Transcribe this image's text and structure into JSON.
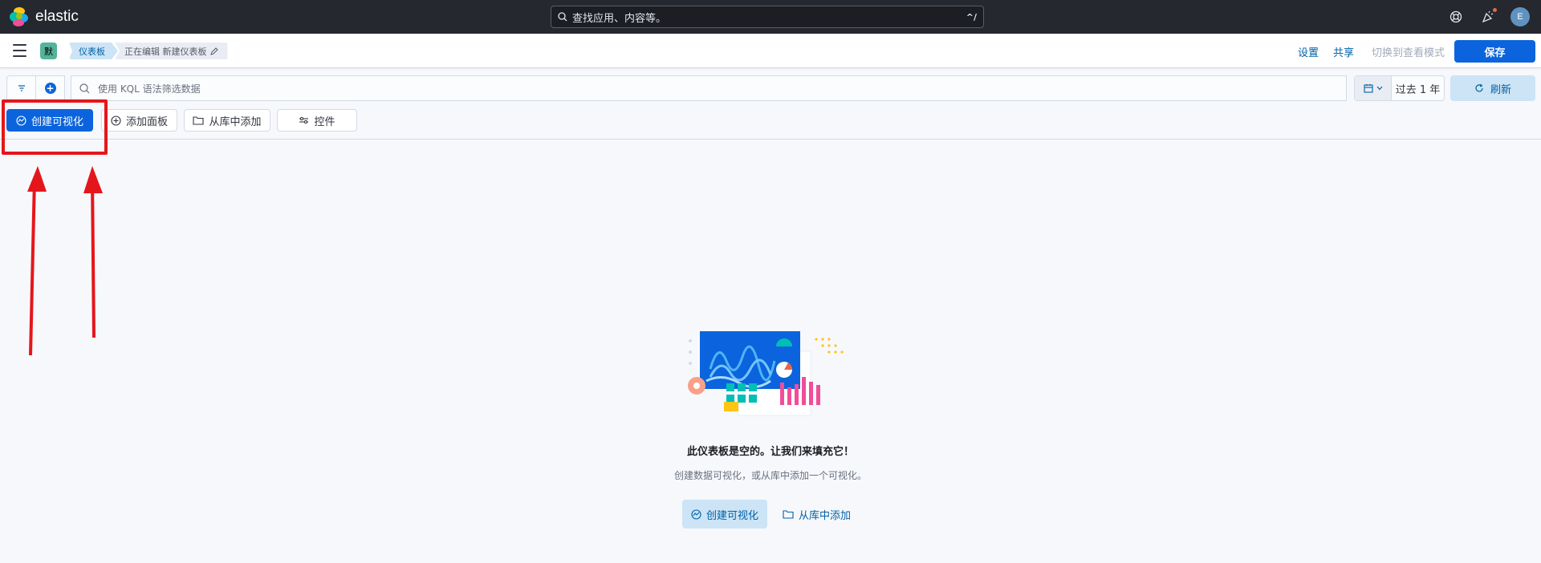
{
  "header": {
    "brand": "elastic",
    "search_placeholder": "查找应用、内容等。",
    "search_shortcut": "^/",
    "avatar_initial": "E"
  },
  "breadcrumbs": {
    "space_initial": "默",
    "items": [
      "仪表板",
      "正在编辑 新建仪表板"
    ]
  },
  "header_actions": {
    "settings": "设置",
    "share": "共享",
    "switch_view": "切换到查看模式",
    "save": "保存"
  },
  "query": {
    "placeholder": "使用 KQL 语法筛选数据",
    "date_range": "过去 1 年",
    "refresh": "刷新"
  },
  "toolbar": {
    "create_visualization": "创建可视化",
    "add_panel": "添加面板",
    "add_from_library": "从库中添加",
    "controls": "控件"
  },
  "empty_state": {
    "title": "此仪表板是空的。让我们来填充它！",
    "description": "创建数据可视化，或从库中添加一个可视化。",
    "create_visualization": "创建可视化",
    "add_from_library": "从库中添加"
  },
  "colors": {
    "primary": "#0b64dd",
    "header_bg": "#25282f",
    "annotation_red": "#e5161b"
  }
}
